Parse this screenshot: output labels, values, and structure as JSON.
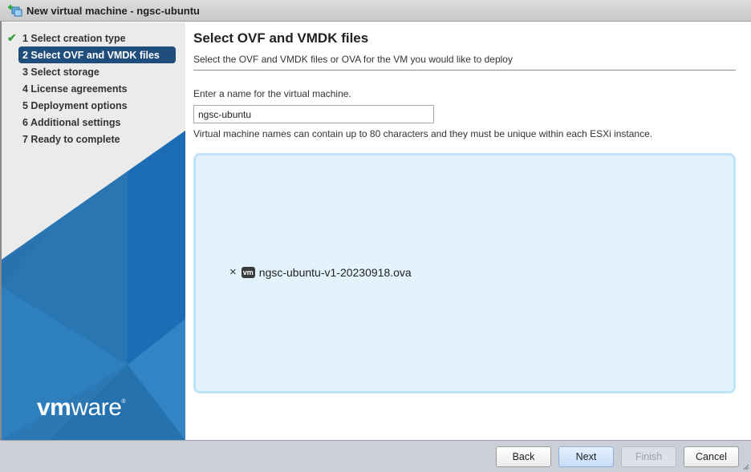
{
  "window": {
    "title": "New virtual machine - ngsc-ubuntu",
    "icon": "new-vm-icon"
  },
  "sidebar": {
    "steps": [
      {
        "label": "1 Select creation type",
        "state": "completed"
      },
      {
        "label": "2 Select OVF and VMDK files",
        "state": "active"
      },
      {
        "label": "3 Select storage",
        "state": "pending"
      },
      {
        "label": "4 License agreements",
        "state": "pending"
      },
      {
        "label": "5 Deployment options",
        "state": "pending"
      },
      {
        "label": "6 Additional settings",
        "state": "pending"
      },
      {
        "label": "7 Ready to complete",
        "state": "pending"
      }
    ],
    "completed_icon": "check-icon",
    "logo": {
      "vm": "vm",
      "ware": "ware",
      "registered": "®"
    },
    "colors": {
      "active_step_bg": "#1f4e7d",
      "check": "#3aa23a",
      "brand_blue": "#1d6fb8"
    }
  },
  "main": {
    "title": "Select OVF and VMDK files",
    "subtitle": "Select the OVF and VMDK files or OVA for the VM you would like to deploy",
    "name_label": "Enter a name for the virtual machine.",
    "name_value": "ngsc-ubuntu",
    "name_hint": "Virtual machine names can contain up to 80 characters and they must be unique within each ESXi instance.",
    "dropzone": {
      "files": [
        {
          "name": "ngsc-ubuntu-v1-20230918.ova",
          "badge": "vm",
          "remove_icon": "×"
        }
      ]
    }
  },
  "footer": {
    "back": "Back",
    "next": "Next",
    "finish": "Finish",
    "cancel": "Cancel",
    "finish_disabled": true
  }
}
